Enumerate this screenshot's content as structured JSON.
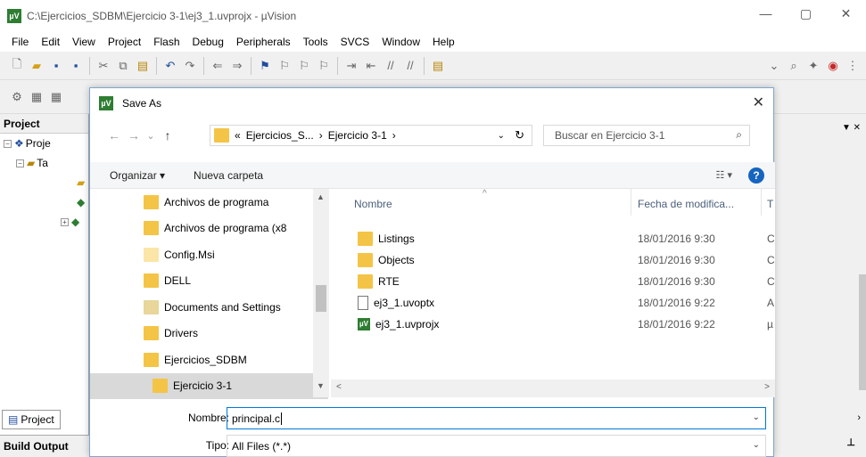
{
  "window": {
    "title": "C:\\Ejercicios_SDBM\\Ejercicio 3-1\\ej3_1.uvprojx - µVision",
    "logo": "µV",
    "minimize": "—",
    "maximize": "▢",
    "close": "✕"
  },
  "menu": [
    "File",
    "Edit",
    "View",
    "Project",
    "Flash",
    "Debug",
    "Peripherals",
    "Tools",
    "SVCS",
    "Window",
    "Help"
  ],
  "project_panel": {
    "header": "Project",
    "root_label": "Proje",
    "target_label": "Ta",
    "tab_label": "Project",
    "build_output": "Build Output"
  },
  "dialog": {
    "title": "Save As",
    "close": "✕",
    "nav": {
      "back": "←",
      "forward": "→",
      "dropdown": "⌄",
      "up": "↑"
    },
    "breadcrumb": {
      "prefix": "«",
      "segments": [
        "Ejercicios_S...",
        "Ejercicio 3-1"
      ],
      "separator": "›",
      "refresh": "↻"
    },
    "search_placeholder": "Buscar en Ejercicio 3-1",
    "organize": "Organizar ▾",
    "new_folder": "Nueva carpeta",
    "view_icon": "☷ ▾",
    "help": "?",
    "nav_items": [
      {
        "label": "Archivos de programa",
        "icon": "folder"
      },
      {
        "label": "Archivos de programa (x8",
        "icon": "folder"
      },
      {
        "label": "Config.Msi",
        "icon": "folder-pale"
      },
      {
        "label": "DELL",
        "icon": "folder"
      },
      {
        "label": "Documents and Settings",
        "icon": "folder-link"
      },
      {
        "label": "Drivers",
        "icon": "folder"
      },
      {
        "label": "Ejercicios_SDBM",
        "icon": "folder"
      },
      {
        "label": "Ejercicio 3-1",
        "icon": "folder",
        "selected": true
      }
    ],
    "columns": {
      "name": "Nombre",
      "date": "Fecha de modifica...",
      "type": "T"
    },
    "files": [
      {
        "name": "Listings",
        "date": "18/01/2016 9:30",
        "type": "C",
        "icon": "folder"
      },
      {
        "name": "Objects",
        "date": "18/01/2016 9:30",
        "type": "C",
        "icon": "folder"
      },
      {
        "name": "RTE",
        "date": "18/01/2016 9:30",
        "type": "C",
        "icon": "folder"
      },
      {
        "name": "ej3_1.uvoptx",
        "date": "18/01/2016 9:22",
        "type": "A",
        "icon": "document"
      },
      {
        "name": "ej3_1.uvprojx",
        "date": "18/01/2016 9:22",
        "type": "µ",
        "icon": "uvision"
      }
    ],
    "filename_label": "Nombre:",
    "filename_value": "principal.c",
    "filetype_label": "Tipo:",
    "filetype_value": "All Files (*.*)"
  }
}
